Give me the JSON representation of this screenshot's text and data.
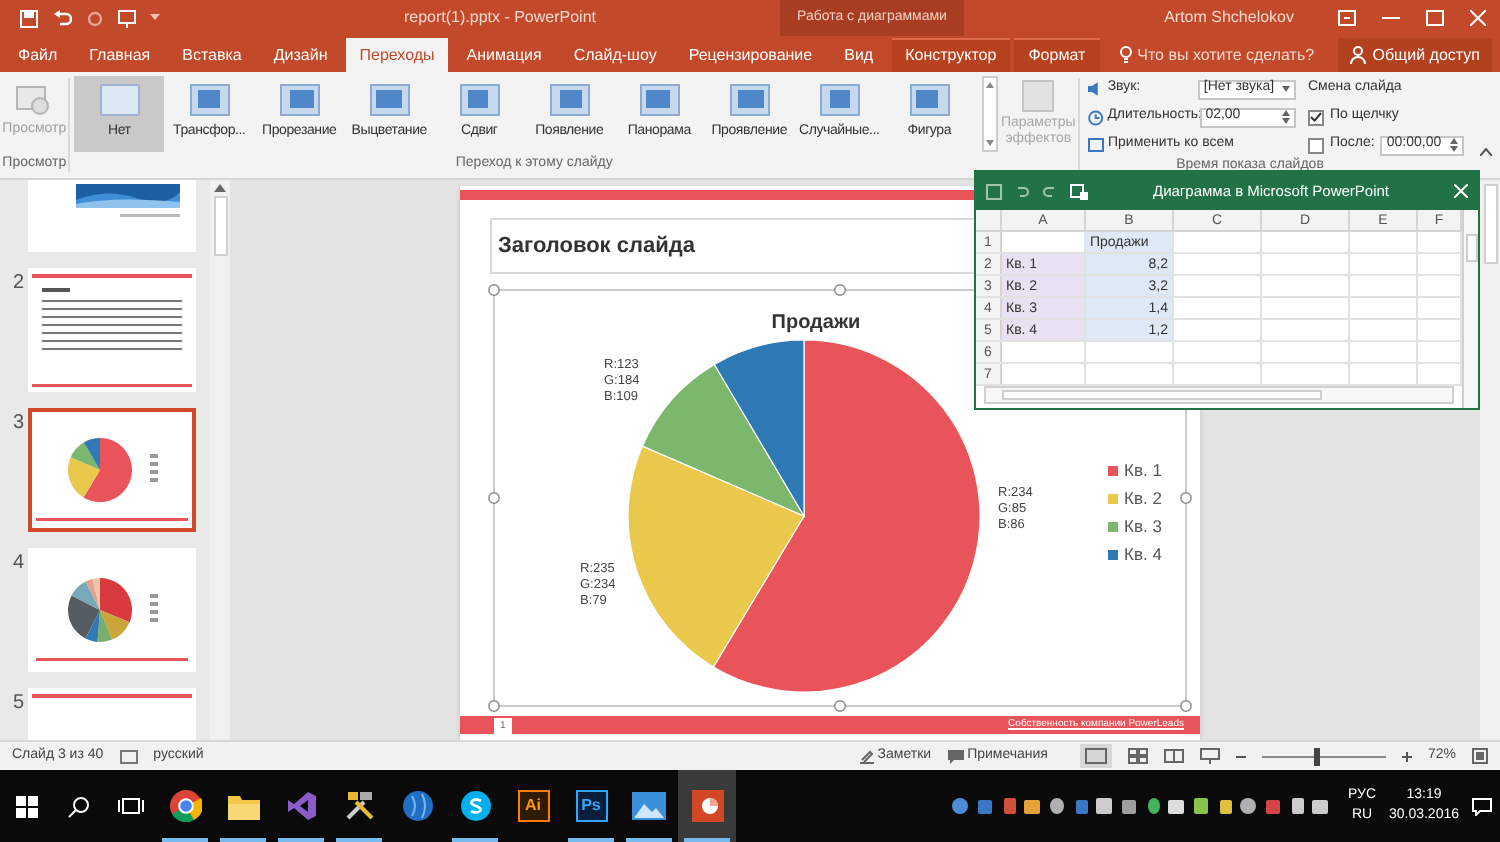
{
  "window": {
    "title": "report(1).pptx - PowerPoint",
    "context_tab_group": "Работа с диаграммами",
    "user": "Artom Shchelokov"
  },
  "tabs": [
    {
      "label": "Файл",
      "selected": false,
      "contextual": false
    },
    {
      "label": "Главная",
      "selected": false,
      "contextual": false
    },
    {
      "label": "Вставка",
      "selected": false,
      "contextual": false
    },
    {
      "label": "Дизайн",
      "selected": false,
      "contextual": false
    },
    {
      "label": "Переходы",
      "selected": true,
      "contextual": false
    },
    {
      "label": "Анимация",
      "selected": false,
      "contextual": false
    },
    {
      "label": "Слайд-шоу",
      "selected": false,
      "contextual": false
    },
    {
      "label": "Рецензирование",
      "selected": false,
      "contextual": false
    },
    {
      "label": "Вид",
      "selected": false,
      "contextual": false
    },
    {
      "label": "Конструктор",
      "selected": false,
      "contextual": true
    },
    {
      "label": "Формат",
      "selected": false,
      "contextual": true
    }
  ],
  "tell_me": {
    "placeholder": "Что вы хотите сделать?"
  },
  "share": {
    "label": "Общий доступ"
  },
  "ribbon": {
    "preview": {
      "label": "Просмотр",
      "disabled": true
    },
    "preview_group": "Просмотр",
    "transitions": [
      {
        "label": "Нет",
        "selected": true
      },
      {
        "label": "Трансфор...",
        "selected": false
      },
      {
        "label": "Прорезание",
        "selected": false
      },
      {
        "label": "Выцветание",
        "selected": false
      },
      {
        "label": "Сдвиг",
        "selected": false
      },
      {
        "label": "Появление",
        "selected": false
      },
      {
        "label": "Панорама",
        "selected": false
      },
      {
        "label": "Проявление",
        "selected": false
      },
      {
        "label": "Случайные...",
        "selected": false
      },
      {
        "label": "Фигура",
        "selected": false
      }
    ],
    "transitions_group": "Переход к этому слайду",
    "effect_options": {
      "label": "Параметры эффектов",
      "disabled": true
    },
    "timing": {
      "sound_label": "Звук:",
      "sound_value": "[Нет звука]",
      "duration_label": "Длительность:",
      "duration_value": "02,00",
      "apply_all": "Применить ко всем",
      "advance_title": "Смена слайда",
      "on_click": {
        "label": "По щелчку",
        "checked": true
      },
      "after": {
        "label": "После:",
        "checked": false,
        "value": "00:00,00"
      },
      "group": "Время показа слайдов"
    }
  },
  "thumbnails": [
    {
      "kind": "title",
      "selected": false
    },
    {
      "number": "2",
      "kind": "list",
      "selected": false
    },
    {
      "number": "3",
      "kind": "pie",
      "selected": true
    },
    {
      "number": "4",
      "kind": "pie-multi",
      "selected": false
    },
    {
      "number": "5",
      "kind": "blank",
      "selected": false
    }
  ],
  "slide": {
    "title": "Заголовок слайда",
    "page": "1",
    "footer": "Собственность компании PowerLeads",
    "chart_data": {
      "type": "pie",
      "title": "Продажи",
      "categories": [
        "Кв. 1",
        "Кв. 2",
        "Кв. 3",
        "Кв. 4"
      ],
      "values": [
        58.6,
        22.9,
        10.0,
        8.5
      ],
      "colors": [
        "#e8545a",
        "#eac84c",
        "#7bb86d",
        "#2f79b5"
      ],
      "legend": "right",
      "annotations": [
        {
          "text": "R:123\nG:184\nB:109"
        },
        {
          "text": "R:234\nG:85\nB:86"
        },
        {
          "text": "R:235\nG:234\nB:79"
        }
      ]
    }
  },
  "sheet": {
    "title": "Диаграмма в Microsoft PowerPoint",
    "columns": [
      {
        "label": "A",
        "color": "#e7e1f1"
      },
      {
        "label": "B",
        "color": "#dfe9f6"
      },
      {
        "label": "C"
      },
      {
        "label": "D"
      },
      {
        "label": "E"
      },
      {
        "label": "F"
      }
    ],
    "rows": [
      {
        "number": "1",
        "b": "Продажи"
      },
      {
        "number": "2",
        "a": "Кв. 1",
        "b": "8,2"
      },
      {
        "number": "3",
        "a": "Кв. 2",
        "b": "3,2"
      },
      {
        "number": "4",
        "a": "Кв. 3",
        "b": "1,4"
      },
      {
        "number": "5",
        "a": "Кв. 4",
        "b": "1,2"
      },
      {
        "number": "6"
      },
      {
        "number": "7"
      }
    ]
  },
  "status_bar": {
    "slide": "Слайд 3 из 40",
    "language": "русский",
    "notes": "Заметки",
    "comments": "Примечания",
    "zoom": {
      "reading": "72%",
      "level": 0.45
    }
  },
  "taskbar": {
    "apps": [
      {
        "kind": "chrome",
        "running": true,
        "active": false
      },
      {
        "kind": "folder",
        "running": true,
        "active": false
      },
      {
        "kind": "studio",
        "running": true,
        "active": false
      },
      {
        "kind": "tools",
        "running": true,
        "active": false
      },
      {
        "kind": "globe",
        "running": false,
        "active": false
      },
      {
        "kind": "skype",
        "running": true,
        "active": false
      },
      {
        "kind": "illustrator",
        "label": "Ai",
        "running": false,
        "active": false
      },
      {
        "kind": "photoshop",
        "label": "Ps",
        "running": true,
        "active": false
      },
      {
        "kind": "photos",
        "running": true,
        "active": false
      },
      {
        "kind": "powerpoint",
        "running": true,
        "active": true
      }
    ],
    "language": "РУС",
    "layout": "RU",
    "time": "13:19",
    "date": "30.03.2016"
  }
}
